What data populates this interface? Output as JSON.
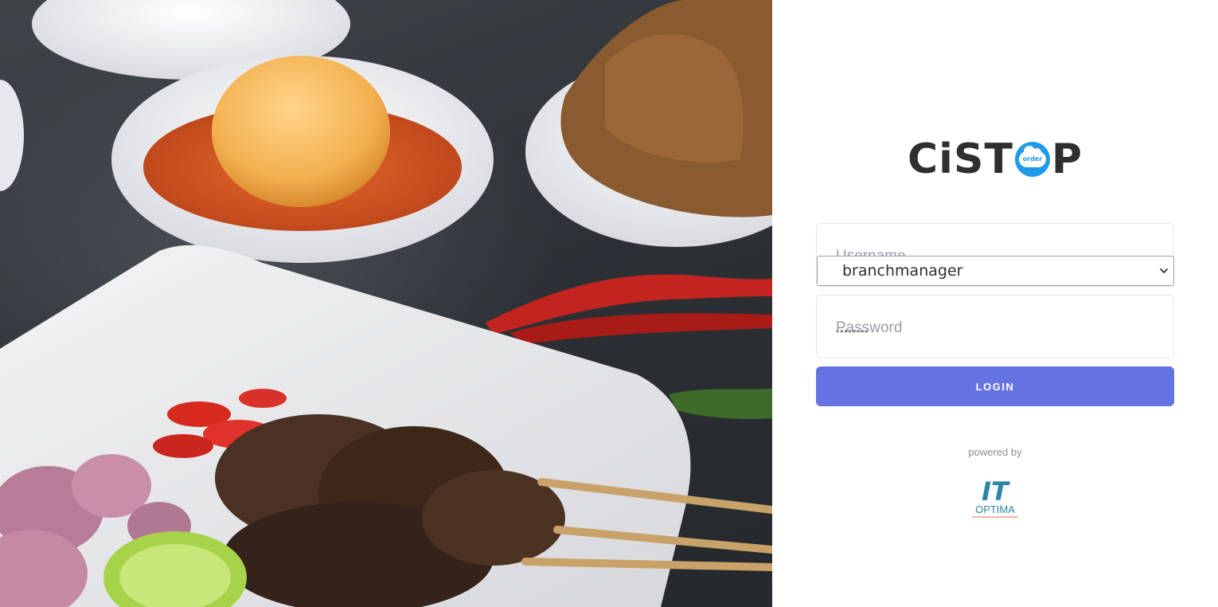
{
  "brand": {
    "logo_text_left": "CiST",
    "logo_text_right": "P",
    "logo_badge_text": "order",
    "accent_color": "#1e9be8"
  },
  "login_form": {
    "username_label": "Username",
    "username_selected": "branchmanager",
    "password_label": "Password",
    "password_mask": "••••••••",
    "login_button": "LOGIN",
    "button_color": "#6673e3"
  },
  "footer": {
    "powered_by": "powered by",
    "partner_logo_text_top": "IT",
    "partner_logo_text_bottom": "OPTIMA"
  },
  "icons": {
    "select": "chevron-down-icon",
    "background": "food-photo"
  }
}
